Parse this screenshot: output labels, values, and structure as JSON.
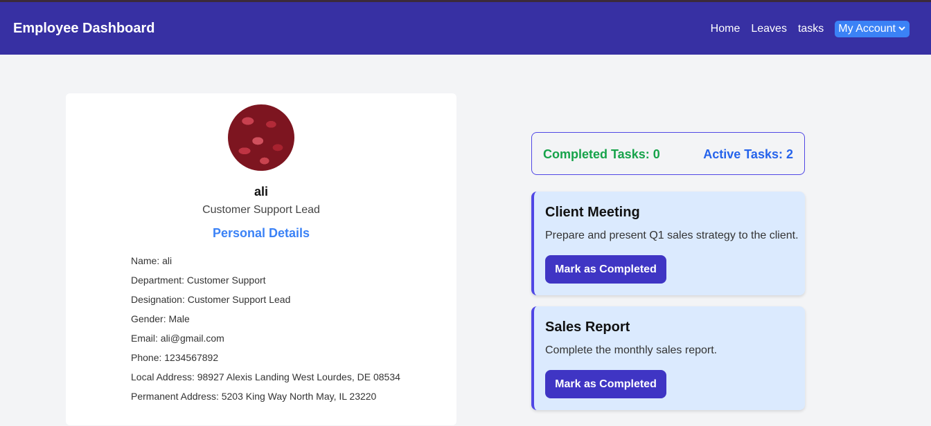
{
  "header": {
    "title": "Employee Dashboard",
    "nav": [
      "Home",
      "Leaves",
      "tasks"
    ],
    "account_label": "My Account"
  },
  "profile": {
    "name": "ali",
    "role": "Customer Support Lead",
    "section_title": "Personal Details",
    "details": [
      "Name: ali",
      "Department: Customer Support",
      "Designation: Customer Support Lead",
      "Gender: Male",
      "Email: ali@gmail.com",
      "Phone: 1234567892",
      "Local Address: 98927 Alexis Landing West Lourdes, DE 08534",
      "Permanent Address: 5203 King Way North May, IL 23220"
    ]
  },
  "stats": {
    "completed": "Completed Tasks: 0",
    "active": "Active Tasks: 2"
  },
  "tasks": [
    {
      "title": "Client Meeting",
      "description": "Prepare and present Q1 sales strategy to the client.",
      "button": "Mark as Completed"
    },
    {
      "title": "Sales Report",
      "description": "Complete the monthly sales report.",
      "button": "Mark as Completed"
    }
  ],
  "colors": {
    "navbar": "#3730a3",
    "accent": "#3b82f6",
    "completed": "#16a34a",
    "active": "#2563eb",
    "button": "#3f35c4",
    "task_bg": "#dbeafe"
  }
}
